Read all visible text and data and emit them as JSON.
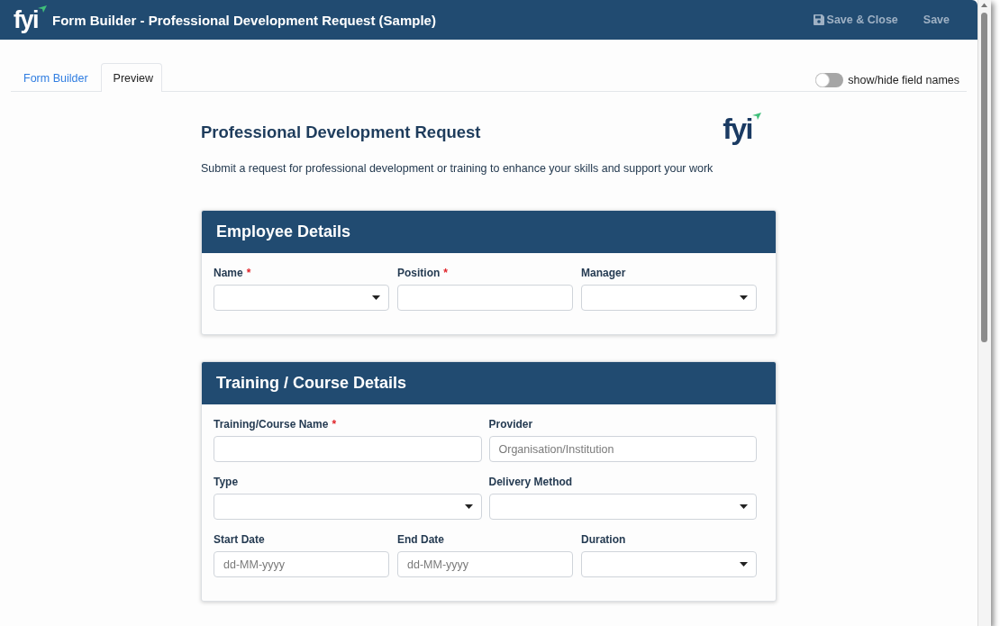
{
  "window": {
    "logo_text": "fyi",
    "title": "Form Builder - Professional Development Request (Sample)"
  },
  "toolbar": {
    "buttons": [
      {
        "label": "Save & Close",
        "kind": "iconed",
        "disabled": true
      },
      {
        "label": "Save",
        "kind": "plain",
        "disabled": true
      }
    ]
  },
  "tabs": [
    {
      "label": "Form Builder",
      "selected": false
    },
    {
      "label": "Preview",
      "selected": true
    }
  ],
  "toggle": {
    "label": "show/hide field names",
    "on": false
  },
  "form": {
    "title": "Professional Development Request",
    "logo_text": "fyi",
    "description": "Submit a request for professional development or training to enhance your skills and support your work",
    "sections": [
      {
        "title": "Employee Details",
        "rows": [
          [
            {
              "label": "Name",
              "required_mark": "*",
              "kind": "select"
            },
            {
              "label": "Position",
              "required_mark": "*",
              "kind": "text"
            },
            {
              "label": "Manager",
              "kind": "select"
            }
          ]
        ]
      },
      {
        "title": "Training / Course Details",
        "rows": [
          [
            {
              "label": "Training/Course Name",
              "required_mark": "*",
              "kind": "text"
            },
            {
              "label": "Provider",
              "kind": "text",
              "placeholder": "Organisation/Institution"
            }
          ],
          [
            {
              "label": "Type",
              "kind": "select"
            },
            {
              "label": "Delivery Method",
              "kind": "select"
            }
          ],
          [
            {
              "label": "Start Date",
              "kind": "date",
              "placeholder": "dd-MM-yyyy"
            },
            {
              "label": "End Date",
              "kind": "date",
              "placeholder": "dd-MM-yyyy"
            },
            {
              "label": "Duration",
              "kind": "select"
            }
          ]
        ]
      }
    ]
  }
}
